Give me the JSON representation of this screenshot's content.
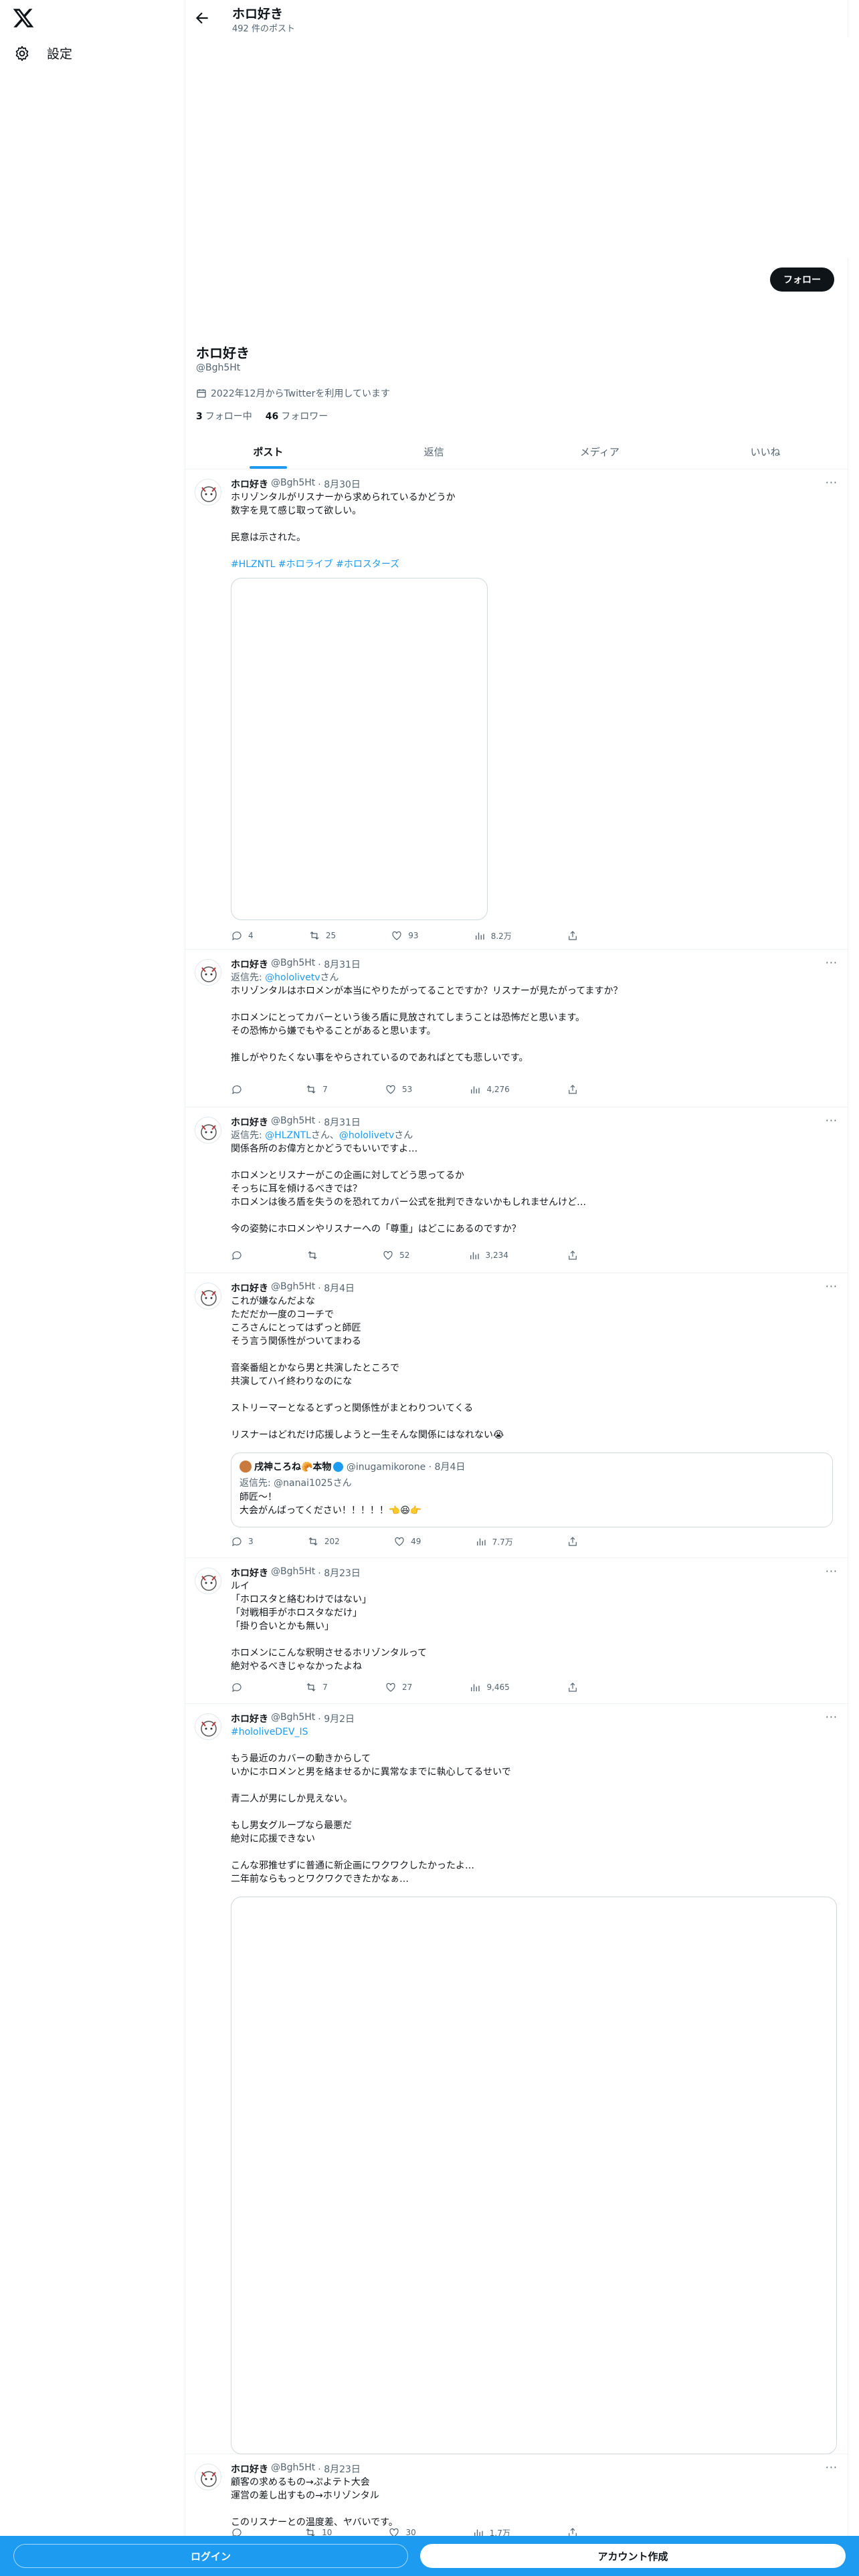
{
  "sidebar": {
    "settings_label": "設定"
  },
  "header": {
    "title": "ホロ好き",
    "post_count": "492 件のポスト"
  },
  "profile": {
    "name": "ホロ好き",
    "handle": "@Bgh5Ht",
    "joined": "2022年12月からTwitterを利用しています",
    "following_count": "3",
    "following_label": "フォロー中",
    "followers_count": "46",
    "followers_label": "フォロワー",
    "follow_button": "フォロー"
  },
  "tabs": [
    "ポスト",
    "返信",
    "メディア",
    "いいね"
  ],
  "tweets": [
    {
      "name": "ホロ好き",
      "handle": "@Bgh5Ht",
      "date": "· 8月30日",
      "text": "ホリゾンタルがリスナーから求められているかどうか\n数字を見て感じ取って欲しい。\n\n民意は示された。",
      "hashtags": "#HLZNTL #ホロライブ #ホロスターズ",
      "replies": "4",
      "reposts": "25",
      "likes": "93",
      "views": "8.2万"
    },
    {
      "name": "ホロ好き",
      "handle": "@Bgh5Ht",
      "date": "· 8月31日",
      "reply_label": "返信先: ",
      "reply_to": "@hololivetv",
      "reply_suffix": "さん",
      "text": "ホリゾンタルはホロメンが本当にやりたがってることですか？リスナーが見たがってますか？\n\nホロメンにとってカバーという後ろ盾に見放されてしまうことは恐怖だと思います。\nその恐怖から嫌でもやることがあると思います。\n\n推しがやりたくない事をやらされているのであればとても悲しいです。",
      "replies": "",
      "reposts": "7",
      "likes": "53",
      "views": "4,276"
    },
    {
      "name": "ホロ好き",
      "handle": "@Bgh5Ht",
      "date": "· 8月31日",
      "reply_label": "返信先: ",
      "reply_to": "@HLZNTL",
      "reply_mid": "さん、",
      "reply_to2": "@hololivetv",
      "reply_suffix": "さん",
      "text": "関係各所のお偉方とかどうでもいいですよ…\n\nホロメンとリスナーがこの企画に対してどう思ってるか\nそっちに耳を傾けるべきでは？\nホロメンは後ろ盾を失うのを恐れてカバー公式を批判できないかもしれませんけど…\n\n今の姿勢にホロメンやリスナーへの「尊重」はどこにあるのですか？",
      "replies": "",
      "reposts": "",
      "likes": "52",
      "views": "3,234"
    },
    {
      "name": "ホロ好き",
      "handle": "@Bgh5Ht",
      "date": "· 8月4日",
      "text": "これが嫌なんだよな\nただだか一度のコーチで\nころさんにとってはずっと師匠\nそう言う関係性がついてまわる\n\n音楽番組とかなら男と共演したところで\n共演してハイ終わりなのにな\n\nストリーマーとなるとずっと関係性がまとわりついてくる\n\nリスナーはどれだけ応援しようと一生そんな関係にはなれない😭",
      "quote_name": "戌神ころね🥐本物",
      "quote_handle": "@inugamikorone · 8月4日",
      "quote_reply_label": "返信先: @nanai1025さん",
      "quote_text": "師匠～！\n大会がんばってください！！！！！👈😆👉",
      "replies": "3",
      "reposts": "202",
      "likes": "49",
      "views": "7.7万"
    },
    {
      "name": "ホロ好き",
      "handle": "@Bgh5Ht",
      "date": "· 8月23日",
      "text": "ルイ\n「ホロスタと絡むわけではない」\n「対戦相手がホロスタなだけ」\n「掛り合いとかも無い」\n\nホロメンにこんな釈明させるホリゾンタルって\n絶対やるべきじゃなかったよね",
      "replies": "",
      "reposts": "7",
      "likes": "27",
      "views": "9,465"
    },
    {
      "name": "ホロ好き",
      "handle": "@Bgh5Ht",
      "date": "· 9月2日",
      "hashtag_top": "#hololiveDEV_IS",
      "text": "もう最近のカバーの動きからして\nいかにホロメンと男を絡ませるかに異常なまでに執心してるせいで\n\n青二人が男にしか見えない。\n\nもし男女グループなら最悪だ\n絶対に応援できない\n\nこんな邪推せずに普通に新企画にワクワクしたかったよ…\n二年前ならもっとワクワクできたかなぁ…"
    },
    {
      "name": "ホロ好き",
      "handle": "@Bgh5Ht",
      "date": "· 8月23日",
      "text": "顧客の求めるもの→ぷよテト大会\n運営の差し出すもの→ホリゾンタル\n\nこのリスナーとの温度差、ヤバいです。",
      "replies": "",
      "reposts": "10",
      "likes": "30",
      "views": "1.7万"
    }
  ],
  "bottom": {
    "login": "ログイン",
    "signup": "アカウント作成"
  }
}
